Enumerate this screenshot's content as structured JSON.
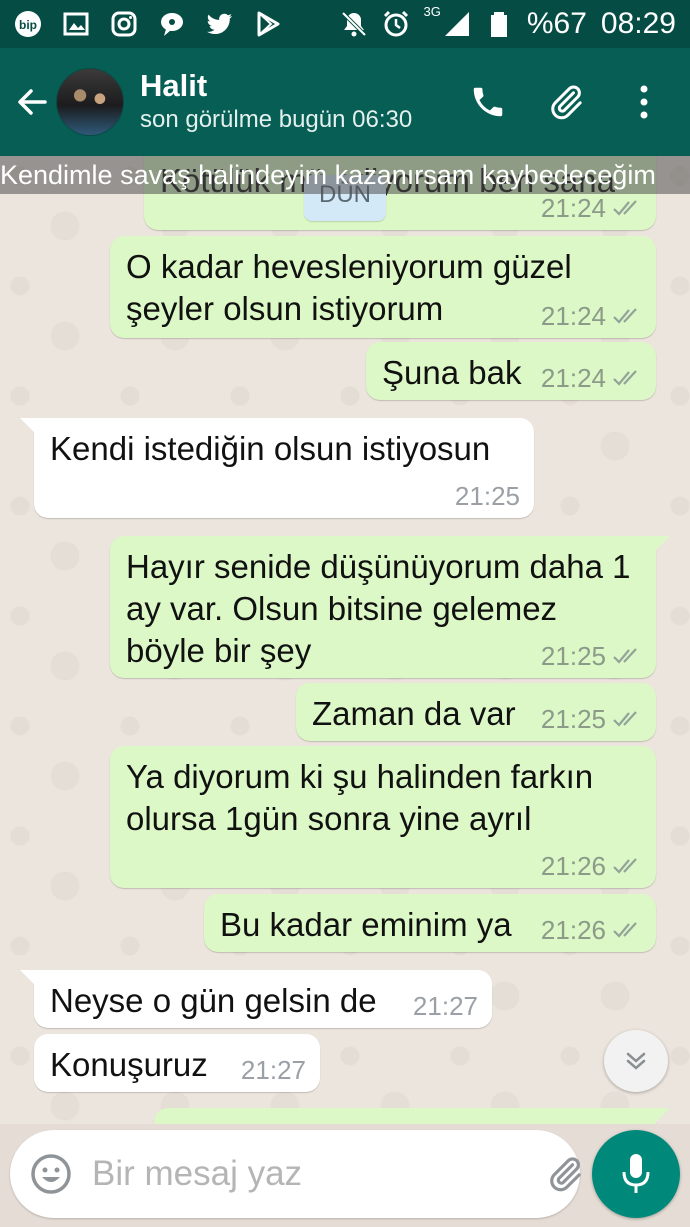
{
  "status_bar": {
    "icons": [
      "bip-icon",
      "image-icon",
      "instagram-icon",
      "chat-bubble-icon",
      "twitter-icon",
      "play-store-icon",
      "mute-icon",
      "alarm-icon",
      "network-icon",
      "battery-icon"
    ],
    "network": "3G",
    "battery": "%67",
    "time": "08:29"
  },
  "header": {
    "name": "Halit",
    "last_seen": "son görülme bugün 06:30"
  },
  "status_banner": "Kendimle savaş halindeyim kazanırsam kaybedeceğim",
  "day_chip": "DÜN",
  "messages": [
    {
      "dir": "out",
      "text": "Kötülük mü ediyorum ben sana",
      "time": "21:24"
    },
    {
      "dir": "out",
      "text": "O kadar hevesleniyorum güzel şeyler olsun istiyorum",
      "time": "21:24"
    },
    {
      "dir": "out",
      "text": "Şuna bak",
      "time": "21:24"
    },
    {
      "dir": "in",
      "text": "Kendi istediğin olsun istiyosun",
      "time": "21:25"
    },
    {
      "dir": "out",
      "text": "Hayır senide düşünüyorum daha 1 ay var. Olsun bitsine gelemez böyle bir şey",
      "time": "21:25"
    },
    {
      "dir": "out",
      "text": "Zaman da var",
      "time": "21:25"
    },
    {
      "dir": "out",
      "text": "Ya diyorum ki şu halinden farkın olursa 1gün sonra yine ayrıl",
      "time": "21:26"
    },
    {
      "dir": "out",
      "text": "Bu kadar eminim ya",
      "time": "21:26"
    },
    {
      "dir": "in",
      "text": "Neyse o gün gelsin de",
      "time": "21:27"
    },
    {
      "dir": "in",
      "text": "Konuşuruz",
      "time": "21:27"
    }
  ],
  "composer": {
    "placeholder": "Bir mesaj yaz",
    "value": ""
  },
  "colors": {
    "header": "#075e54",
    "statusbar": "#054d44",
    "outgoing": "#dcf8c6",
    "incoming": "#ffffff",
    "fab": "#00897b"
  }
}
